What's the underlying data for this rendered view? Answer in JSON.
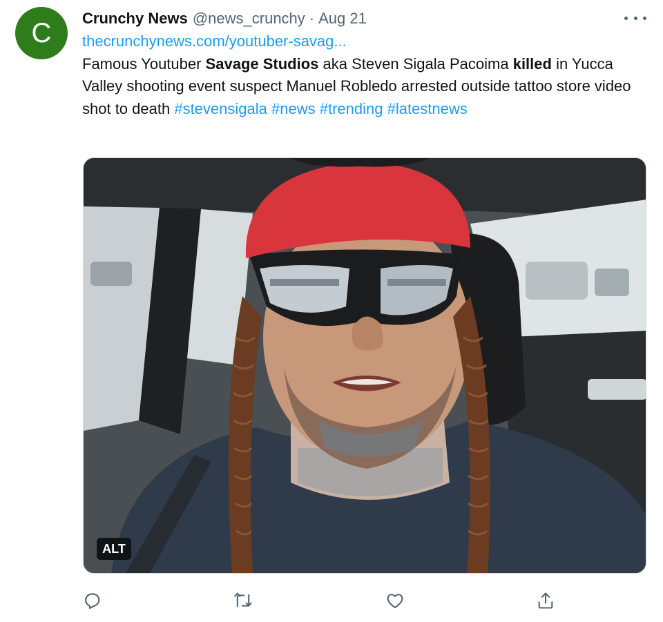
{
  "tweet": {
    "avatar_letter": "C",
    "display_name": "Crunchy News",
    "handle": "@news_crunchy",
    "separator": "·",
    "date": "Aug 21",
    "link": "thecrunchynews.com/youtuber-savag...",
    "text": {
      "t1": "Famous Youtuber ",
      "b1": "Savage Studios",
      "t2": " aka Steven Sigala Pacoima ",
      "b2": "killed",
      "t3": " in Yucca Valley shooting event suspect Manuel Robledo arrested outside tattoo store video shot to death "
    },
    "hashtags": [
      "#stevensigala",
      "#news",
      "#trending",
      "#latestnews"
    ],
    "media": {
      "alt_label": "ALT"
    },
    "actions": [
      "reply-icon",
      "retweet-icon",
      "like-icon",
      "share-icon"
    ]
  },
  "colors": {
    "avatar_bg": "#2e7d1b",
    "link": "#1d9bf0",
    "secondary_text": "#536471",
    "primary_text": "#0f1419"
  }
}
